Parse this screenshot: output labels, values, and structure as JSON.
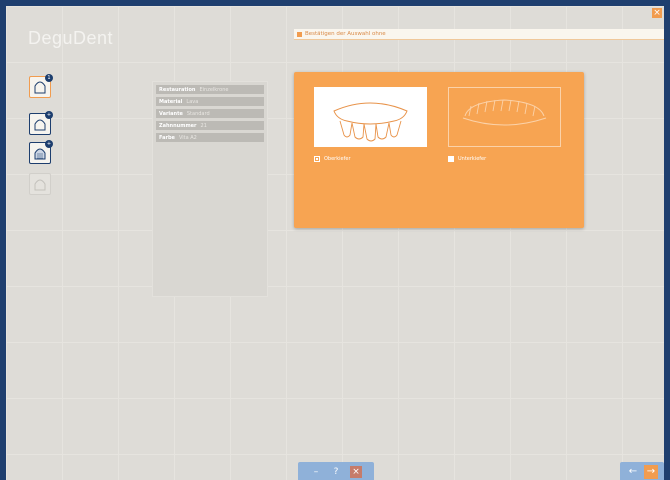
{
  "app": {
    "logo": "DeguDent",
    "title": "Bestätigen der Auswahl ohne"
  },
  "toolbar": {
    "tools": [
      {
        "name": "crown-tool",
        "badge": "1"
      },
      {
        "name": "bridge-tool",
        "badge": "+"
      },
      {
        "name": "model-tool",
        "badge": "+"
      },
      {
        "name": "disabled-tool",
        "badge": ""
      }
    ]
  },
  "parameters": [
    {
      "label": "Restauration",
      "value": "Einzelkrone"
    },
    {
      "label": "Material",
      "value": "Lava"
    },
    {
      "label": "Variante",
      "value": "Standard"
    },
    {
      "label": "Zahnnummer",
      "value": "21"
    },
    {
      "label": "Farbe",
      "value": "Vita A2"
    }
  ],
  "selection": {
    "options": [
      {
        "label": "Oberkiefer",
        "selected": true
      },
      {
        "label": "Unterkiefer",
        "selected": false
      }
    ]
  },
  "bottom_bar": {
    "help_label": "?",
    "stop_label": "×",
    "back_label": "←",
    "next_label": "→"
  },
  "colors": {
    "accent": "#f7a452",
    "frame": "#1f3f6f",
    "background": "#dedcd7"
  },
  "close_label": "×"
}
